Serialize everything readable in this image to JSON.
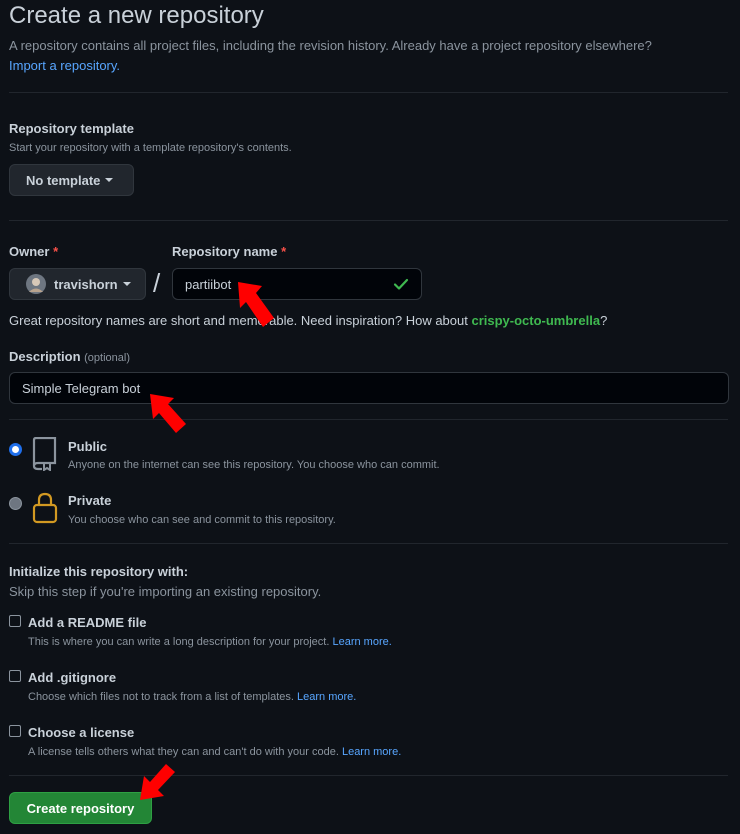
{
  "header": {
    "title": "Create a new repository",
    "subtitle": "A repository contains all project files, including the revision history. Already have a project repository elsewhere?",
    "import_link": "Import a repository."
  },
  "template": {
    "label": "Repository template",
    "hint": "Start your repository with a template repository's contents.",
    "button_label": "No template"
  },
  "owner": {
    "label": "Owner",
    "required_mark": "*",
    "value": "travishorn"
  },
  "separator": "/",
  "repo_name": {
    "label": "Repository name",
    "required_mark": "*",
    "value": "partiibot"
  },
  "name_hint": {
    "before": "Great repository names are short and memorable. Need inspiration? How about ",
    "suggestion": "crispy-octo-umbrella",
    "after": "?"
  },
  "description": {
    "label": "Description",
    "optional": "(optional)",
    "value": "Simple Telegram bot"
  },
  "visibility": {
    "public": {
      "title": "Public",
      "desc": "Anyone on the internet can see this repository. You choose who can commit.",
      "selected": true
    },
    "private": {
      "title": "Private",
      "desc": "You choose who can see and commit to this repository.",
      "selected": false
    }
  },
  "init": {
    "label": "Initialize this repository with:",
    "hint": "Skip this step if you're importing an existing repository.",
    "readme": {
      "title": "Add a README file",
      "desc": "This is where you can write a long description for your project.",
      "link": "Learn more."
    },
    "gitignore": {
      "title": "Add .gitignore",
      "desc": "Choose which files not to track from a list of templates.",
      "link": "Learn more."
    },
    "license": {
      "title": "Choose a license",
      "desc": "A license tells others what they can and can't do with your code.",
      "link": "Learn more."
    }
  },
  "create_button": "Create repository",
  "colors": {
    "background": "#0d1117",
    "accent_green": "#238636",
    "link_blue": "#58a6ff",
    "arrow_red": "#ff0000"
  }
}
